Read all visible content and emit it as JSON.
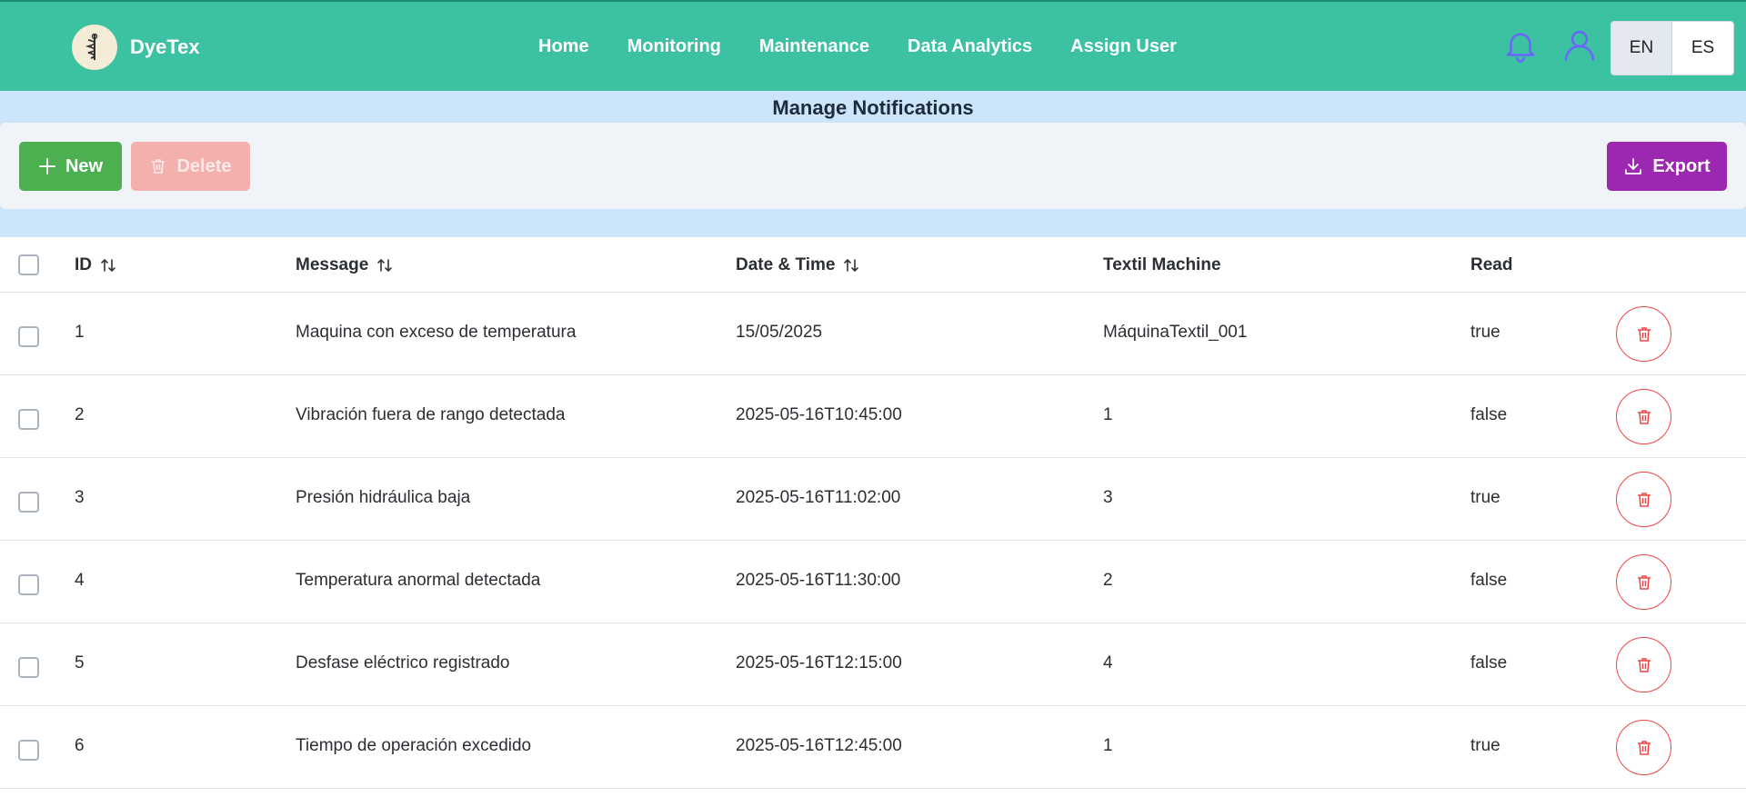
{
  "brand": {
    "name": "DyeTex"
  },
  "nav": {
    "links": [
      "Home",
      "Monitoring",
      "Maintenance",
      "Data Analytics",
      "Assign User"
    ]
  },
  "header_icons": [
    "bell-icon",
    "user-icon"
  ],
  "language": {
    "options": [
      "EN",
      "ES"
    ],
    "selected": "EN"
  },
  "page": {
    "title": "Manage Notifications"
  },
  "toolbar": {
    "new_label": "New",
    "delete_label": "Delete",
    "export_label": "Export"
  },
  "table": {
    "columns": [
      "ID",
      "Message",
      "Date & Time",
      "Textil Machine",
      "Read"
    ],
    "sortable": [
      "ID",
      "Message",
      "Date & Time"
    ],
    "rows": [
      {
        "id": "1",
        "message": "Maquina con exceso de temperatura",
        "datetime": "15/05/2025",
        "machine": "MáquinaTextil_001",
        "read": "true"
      },
      {
        "id": "2",
        "message": "Vibración fuera de rango detectada",
        "datetime": "2025-05-16T10:45:00",
        "machine": "1",
        "read": "false"
      },
      {
        "id": "3",
        "message": "Presión hidráulica baja",
        "datetime": "2025-05-16T11:02:00",
        "machine": "3",
        "read": "true"
      },
      {
        "id": "4",
        "message": "Temperatura anormal detectada",
        "datetime": "2025-05-16T11:30:00",
        "machine": "2",
        "read": "false"
      },
      {
        "id": "5",
        "message": "Desfase eléctrico registrado",
        "datetime": "2025-05-16T12:15:00",
        "machine": "4",
        "read": "false"
      },
      {
        "id": "6",
        "message": "Tiempo de operación excedido",
        "datetime": "2025-05-16T12:45:00",
        "machine": "1",
        "read": "true"
      }
    ]
  },
  "colors": {
    "navbar": "#3cc1a3",
    "accent_new": "#4caf50",
    "accent_delete": "#f4b0ad",
    "accent_export": "#9c27b0",
    "title_bar": "#cce5fb",
    "icon_blue": "#6c63ff",
    "danger": "#ef4444"
  }
}
